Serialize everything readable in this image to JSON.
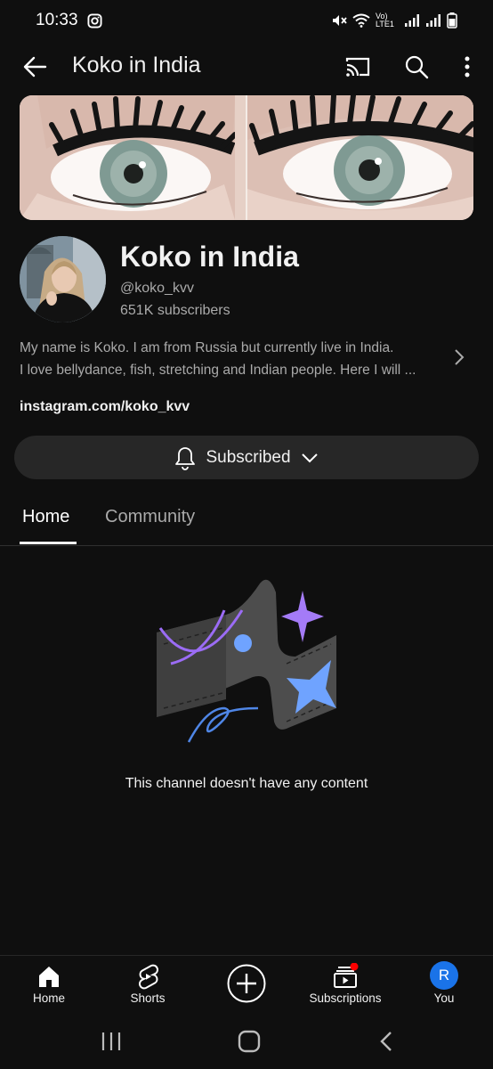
{
  "status_bar": {
    "time": "10:33",
    "network": "Vo) LTE1"
  },
  "header": {
    "title": "Koko in India",
    "icons": [
      "back-arrow-icon",
      "cast-icon",
      "search-icon",
      "more-vert-icon"
    ]
  },
  "channel": {
    "name": "Koko in India",
    "handle": "@koko_kvv",
    "subscribers": "651K subscribers",
    "description_line1": "My name is Koko. I am from Russia but currently live in India.",
    "description_line2": "I love bellydance, fish, stretching and Indian people. Here I will ...",
    "link": "instagram.com/koko_kvv"
  },
  "subscribe": {
    "label": "Subscribed",
    "icon": "bell-icon",
    "dropdown_icon": "chevron-down-icon"
  },
  "tabs": [
    {
      "label": "Home",
      "selected": true
    },
    {
      "label": "Community",
      "selected": false
    }
  ],
  "empty_state": {
    "message": "This channel doesn't have any content"
  },
  "bottom_nav": [
    {
      "label": "Home",
      "icon": "home-icon"
    },
    {
      "label": "Shorts",
      "icon": "shorts-icon"
    },
    {
      "label": "",
      "icon": "create-icon"
    },
    {
      "label": "Subscriptions",
      "icon": "subscriptions-icon"
    },
    {
      "label": "You",
      "icon": "avatar",
      "avatar_letter": "R"
    }
  ],
  "colors": {
    "background": "#0f0f0f",
    "surface": "#272727",
    "secondary_text": "#aaaaaa",
    "notification_dot": "#ff0000",
    "avatar_blue": "#1a73e8"
  }
}
